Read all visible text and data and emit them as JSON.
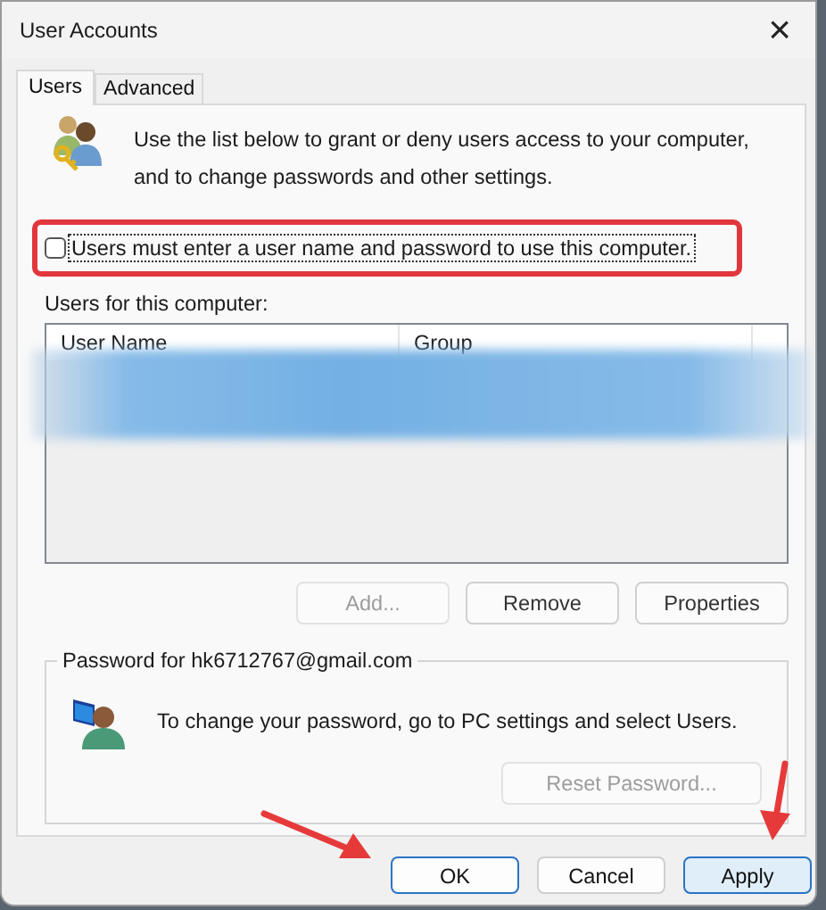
{
  "window": {
    "title": "User Accounts",
    "close": "×"
  },
  "tabs": [
    {
      "label": "Users",
      "selected": true
    },
    {
      "label": "Advanced",
      "selected": false
    }
  ],
  "intro": "Use the list below to grant or deny users access to your computer, and to change passwords and other settings.",
  "require_password": {
    "label": "Users must enter a user name and password to use this computer.",
    "checked": false
  },
  "users_label": "Users for this computer:",
  "table": {
    "columns": [
      "User Name",
      "Group"
    ]
  },
  "list_buttons": [
    {
      "label": "Add...",
      "disabled": true
    },
    {
      "label": "Remove",
      "disabled": false
    },
    {
      "label": "Properties",
      "disabled": false
    }
  ],
  "password_group": {
    "title": "Password for hk6712767@gmail.com",
    "text": "To change your password, go to PC settings and select Users.",
    "button": {
      "label": "Reset Password...",
      "disabled": true
    }
  },
  "footer_buttons": [
    {
      "label": "OK",
      "default": true,
      "hovered": false
    },
    {
      "label": "Cancel",
      "default": false,
      "hovered": false
    },
    {
      "label": "Apply",
      "default": false,
      "hovered": true
    }
  ]
}
